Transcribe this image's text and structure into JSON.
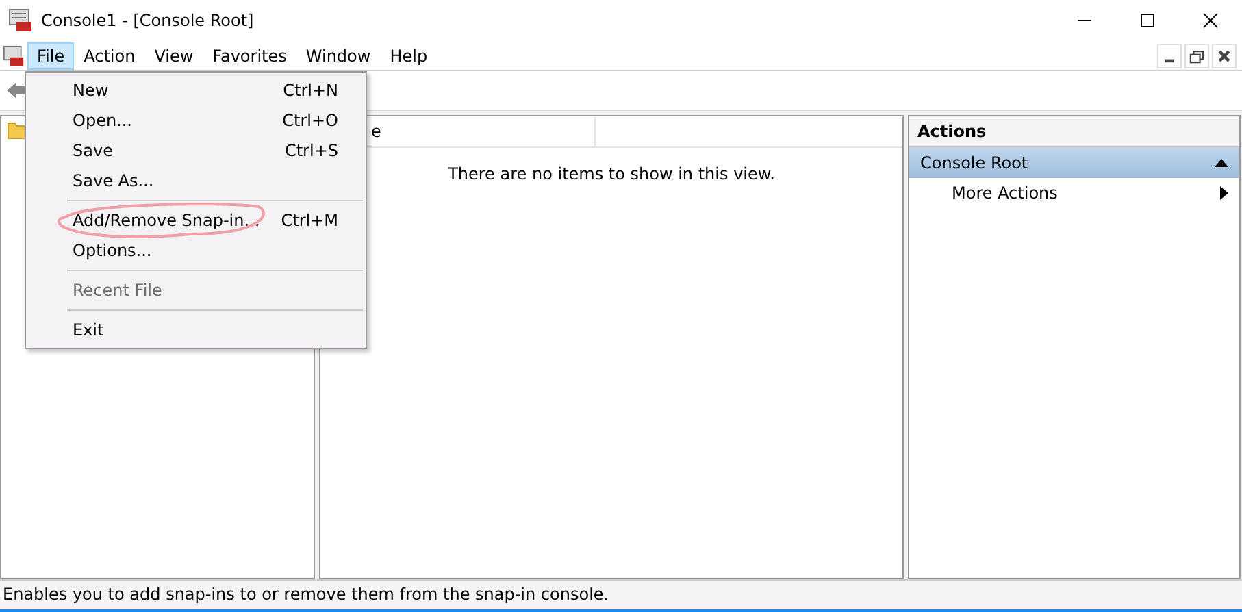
{
  "window": {
    "title": "Console1 - [Console Root]"
  },
  "menu_bar": [
    {
      "label": "File",
      "selected": true
    },
    {
      "label": "Action",
      "selected": false
    },
    {
      "label": "View",
      "selected": false
    },
    {
      "label": "Favorites",
      "selected": false
    },
    {
      "label": "Window",
      "selected": false
    },
    {
      "label": "Help",
      "selected": false
    }
  ],
  "file_menu": [
    {
      "kind": "item",
      "label": "New",
      "shortcut": "Ctrl+N",
      "disabled": false,
      "annotated": false
    },
    {
      "kind": "item",
      "label": "Open...",
      "shortcut": "Ctrl+O",
      "disabled": false,
      "annotated": false
    },
    {
      "kind": "item",
      "label": "Save",
      "shortcut": "Ctrl+S",
      "disabled": false,
      "annotated": false
    },
    {
      "kind": "item",
      "label": "Save As...",
      "disabled": false,
      "annotated": false
    },
    {
      "kind": "separator"
    },
    {
      "kind": "item",
      "label": "Add/Remove Snap-in...",
      "shortcut": "Ctrl+M",
      "disabled": false,
      "annotated": true
    },
    {
      "kind": "item",
      "label": "Options...",
      "disabled": false,
      "annotated": false
    },
    {
      "kind": "separator"
    },
    {
      "kind": "item",
      "label": "Recent File",
      "disabled": true,
      "annotated": false
    },
    {
      "kind": "separator"
    },
    {
      "kind": "item",
      "label": "Exit",
      "disabled": false,
      "annotated": false
    }
  ],
  "center_pane": {
    "column_1": "e",
    "empty_message": "There are no items to show in this view."
  },
  "actions_pane": {
    "title": "Actions",
    "section": "Console Root",
    "items": [
      "More Actions"
    ]
  },
  "status_bar": "Enables you to add snap-ins to or remove them from the snap-in console."
}
